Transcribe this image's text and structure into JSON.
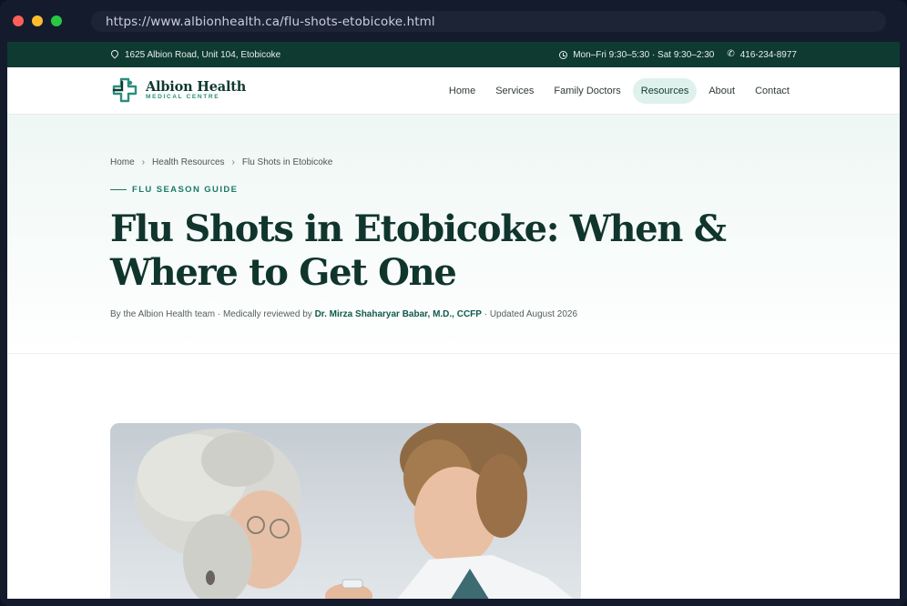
{
  "browser": {
    "url": "https://www.albionhealth.ca/flu-shots-etobicoke.html"
  },
  "topbar": {
    "address": "1625 Albion Road, Unit 104, Etobicoke",
    "hours": "Mon–Fri 9:30–5:30 · Sat 9:30–2:30",
    "phone": "416-234-8977"
  },
  "brand": {
    "name": "Albion Health",
    "subtitle": "MEDICAL CENTRE",
    "colors": {
      "primary": "#0f3a31",
      "accent": "#2a8f7c",
      "highlight": "#dff1ec"
    }
  },
  "nav": {
    "items": [
      {
        "label": "Home"
      },
      {
        "label": "Services"
      },
      {
        "label": "Family Doctors"
      },
      {
        "label": "Resources",
        "active": true
      },
      {
        "label": "About"
      },
      {
        "label": "Contact"
      }
    ]
  },
  "breadcrumb": {
    "items": [
      "Home",
      "Health Resources",
      "Flu Shots in Etobicoke"
    ]
  },
  "article": {
    "eyebrow": "FLU SEASON GUIDE",
    "title": "Flu Shots in Etobicoke: When & Where to Get One",
    "byline_prefix": "By the Albion Health team · Medically reviewed by ",
    "reviewer": "Dr. Mirza Shaharyar Babar, M.D., CCFP",
    "byline_suffix": " · Updated August 2026"
  },
  "icons": {
    "address": "map-pin-icon",
    "hours": "clock-icon",
    "phone": "phone-icon",
    "logo": "medical-cross-logo"
  }
}
